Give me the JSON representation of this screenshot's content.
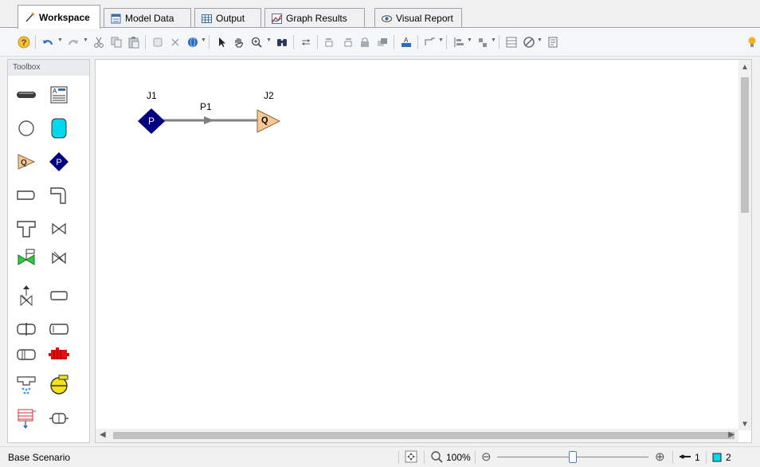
{
  "tabs": [
    {
      "label": "Workspace",
      "icon": "workspace-icon"
    },
    {
      "label": "Model Data",
      "icon": "model-data-icon"
    },
    {
      "label": "Output",
      "icon": "output-table-icon"
    },
    {
      "label": "Graph Results",
      "icon": "graph-icon"
    },
    {
      "label": "Visual Report",
      "icon": "eye-icon"
    }
  ],
  "toolbox": {
    "title": "Toolbox"
  },
  "canvas": {
    "nodes": {
      "j1": {
        "label": "J1",
        "symbol": "P",
        "type": "pressure-junction"
      },
      "j2": {
        "label": "J2",
        "symbol": "Q",
        "type": "flow-junction"
      }
    },
    "pipe": {
      "label": "P1"
    }
  },
  "statusbar": {
    "scenario": "Base Scenario",
    "zoom": "100%",
    "zoom_level": 0.5,
    "pipes_count": "1",
    "junctions_count": "2"
  },
  "colors": {
    "pressure_node": "#000080",
    "flow_node": "#f5c896",
    "accent": "#0078d7"
  }
}
